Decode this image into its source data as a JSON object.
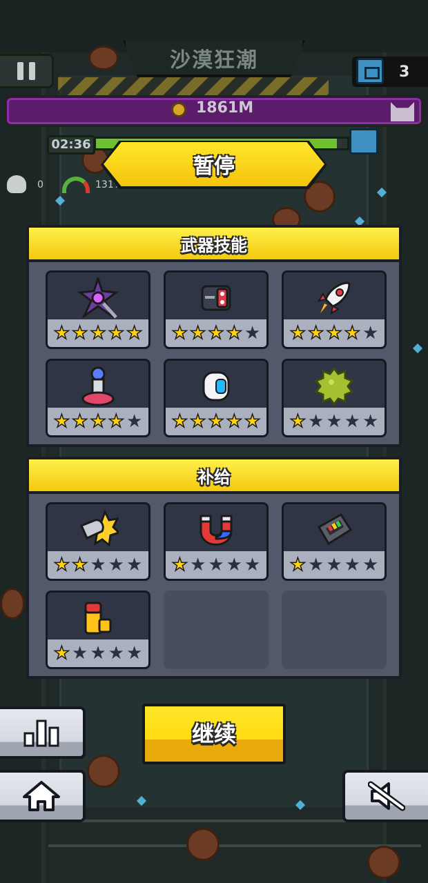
{
  "hud": {
    "stage_title": "沙漠狂潮",
    "chest_count": "3",
    "boss_value": "1861M",
    "timer": "02:36",
    "progress_fraction": 0.96,
    "kill_count": "0",
    "gauge_percent": "131%"
  },
  "pause_title": "暂停",
  "weapon_section": {
    "title": "武器技能",
    "cards": [
      {
        "icon": "spiked-shuriken-icon",
        "stars": 5
      },
      {
        "icon": "robot-head-icon",
        "stars": 4
      },
      {
        "icon": "rocket-icon",
        "stars": 4
      },
      {
        "icon": "tesla-coil-icon",
        "stars": 4
      },
      {
        "icon": "drone-capsule-icon",
        "stars": 5
      },
      {
        "icon": "durian-icon",
        "stars": 1
      }
    ]
  },
  "supply_section": {
    "title": "补给",
    "cards": [
      {
        "icon": "bullet-blast-icon",
        "stars": 2
      },
      {
        "icon": "magnet-icon",
        "stars": 1
      },
      {
        "icon": "battery-pack-icon",
        "stars": 1
      },
      {
        "icon": "battery-cell-icon",
        "stars": 1
      }
    ]
  },
  "max_stars": 5,
  "buttons": {
    "continue_label": "继续",
    "stats_icon": "bar-chart-icon",
    "home_icon": "home-icon",
    "mute_icon": "sound-muted-icon"
  },
  "colors": {
    "accent_yellow": "#ffdc12",
    "panel": "#52596a",
    "card": "#2f3545",
    "boss_bar": "#5a1c6b"
  }
}
